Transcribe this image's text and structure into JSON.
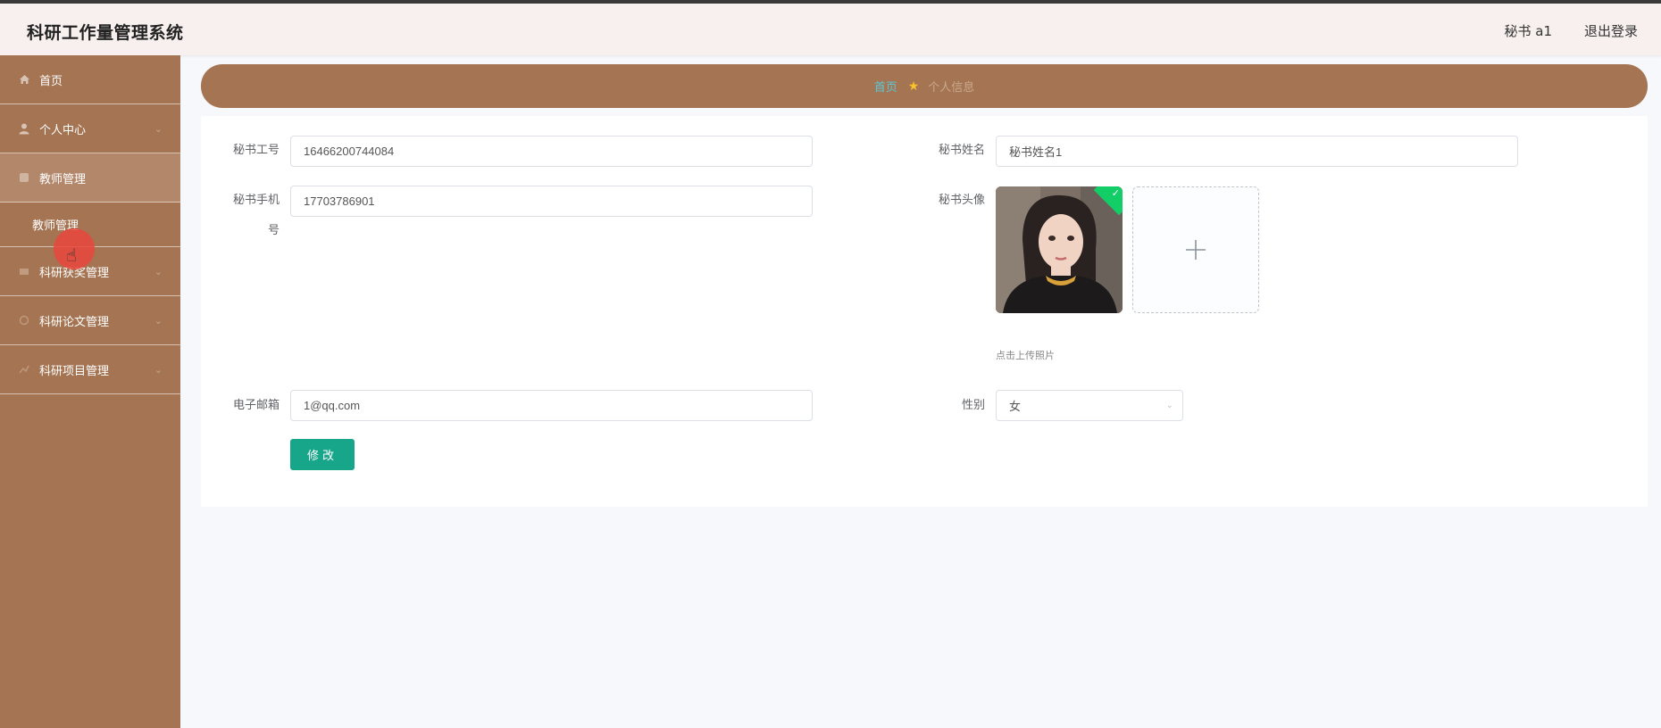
{
  "header": {
    "app_title": "科研工作量管理系统",
    "user_name": "秘书 a1",
    "logout_label": "退出登录"
  },
  "sidebar": {
    "items": [
      {
        "label": "首页",
        "icon": "home-icon"
      },
      {
        "label": "个人中心",
        "icon": "user-icon"
      },
      {
        "label": "教师管理",
        "icon": "teacher-icon"
      },
      {
        "label": "科研获奖管理",
        "icon": "award-icon"
      },
      {
        "label": "科研论文管理",
        "icon": "paper-icon"
      },
      {
        "label": "科研项目管理",
        "icon": "project-icon"
      }
    ],
    "submenu_label": "教师管理"
  },
  "breadcrumb": {
    "home": "首页",
    "current": "个人信息"
  },
  "form": {
    "employee_id_label": "秘书工号",
    "employee_id_value": "16466200744084",
    "name_label": "秘书姓名",
    "name_value": "秘书姓名1",
    "phone_label_line1": "秘书手机",
    "phone_label_line2": "号",
    "phone_value": "17703786901",
    "avatar_label": "秘书头像",
    "upload_hint": "点击上传照片",
    "email_label": "电子邮箱",
    "email_value": "1@qq.com",
    "gender_label": "性别",
    "gender_value": "女",
    "submit_label": "修改"
  },
  "colors": {
    "sidebar": "#a57452",
    "accent_button": "#18a68a",
    "breadcrumb_home": "#5ac8d8"
  }
}
